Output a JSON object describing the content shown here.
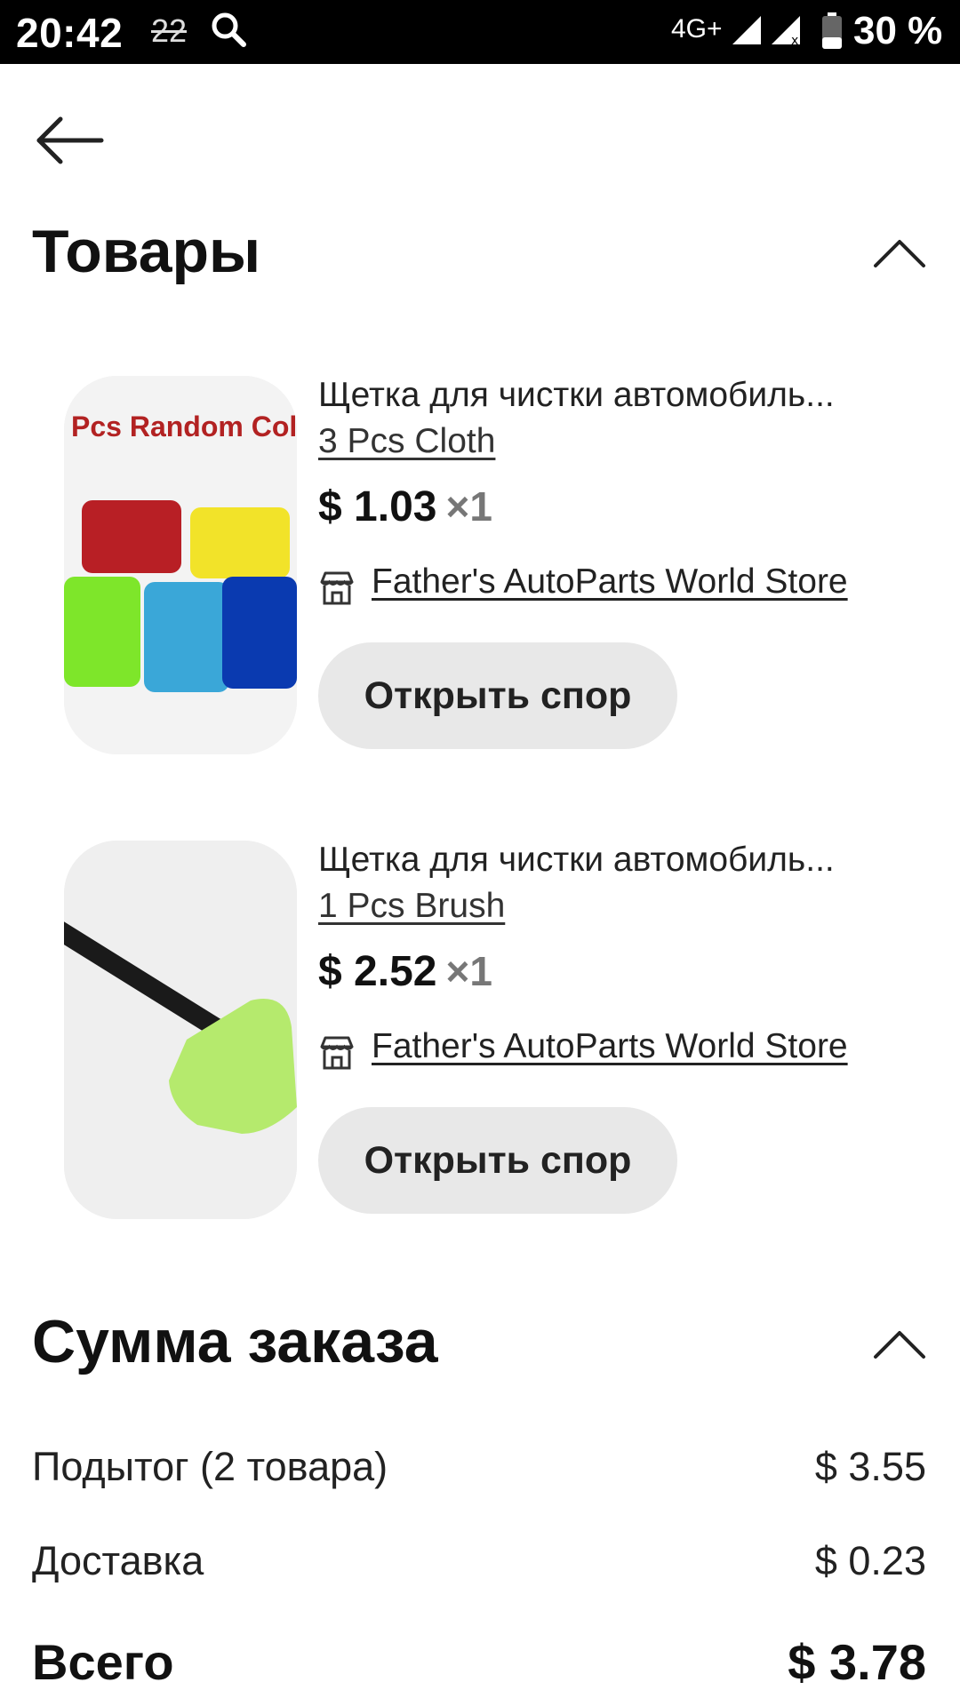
{
  "status_bar": {
    "time": "20:42",
    "notification_count": "22",
    "network": "4G+",
    "battery": "30 %"
  },
  "products": {
    "title": "Товары",
    "items": [
      {
        "title": "Щетка для чистки автомобиль...",
        "variant": "3 Pcs Cloth",
        "price": "$ 1.03",
        "qty": "×1",
        "store": "Father's AutoParts World Store",
        "dispute_label": "Открыть спор",
        "image_text": "Pcs Random Colo"
      },
      {
        "title": "Щетка для чистки автомобиль...",
        "variant": "1 Pcs Brush",
        "price": "$ 2.52",
        "qty": "×1",
        "store": "Father's AutoParts World Store",
        "dispute_label": "Открыть спор"
      }
    ]
  },
  "summary": {
    "title": "Сумма заказа",
    "subtotal_label": "Подытог (2 товара)",
    "subtotal_value": "$ 3.55",
    "shipping_label": "Доставка",
    "shipping_value": "$ 0.23",
    "total_label": "Всего",
    "total_value": "$ 3.78"
  },
  "icons": {
    "back": "arrow-left-icon",
    "collapse": "chevron-up-icon",
    "store": "store-icon"
  }
}
